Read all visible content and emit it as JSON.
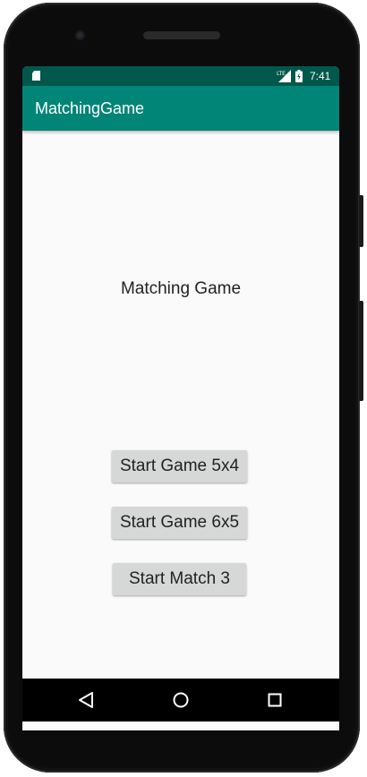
{
  "status_bar": {
    "time": "7:41",
    "network": "LTE",
    "icons": [
      "sd-card-icon",
      "lte-signal-icon",
      "battery-icon"
    ]
  },
  "app_bar": {
    "title": "MatchingGame"
  },
  "main": {
    "title": "Matching Game",
    "buttons": [
      {
        "label": "Start Game 5x4"
      },
      {
        "label": "Start Game 6x5"
      },
      {
        "label": "Start Match 3"
      }
    ]
  },
  "nav_bar": {
    "icons": [
      "back-icon",
      "home-icon",
      "recents-icon"
    ]
  },
  "colors": {
    "status_bar": "#00574b",
    "app_bar": "#008577",
    "background": "#fafafa",
    "button": "#d6d7d7"
  }
}
